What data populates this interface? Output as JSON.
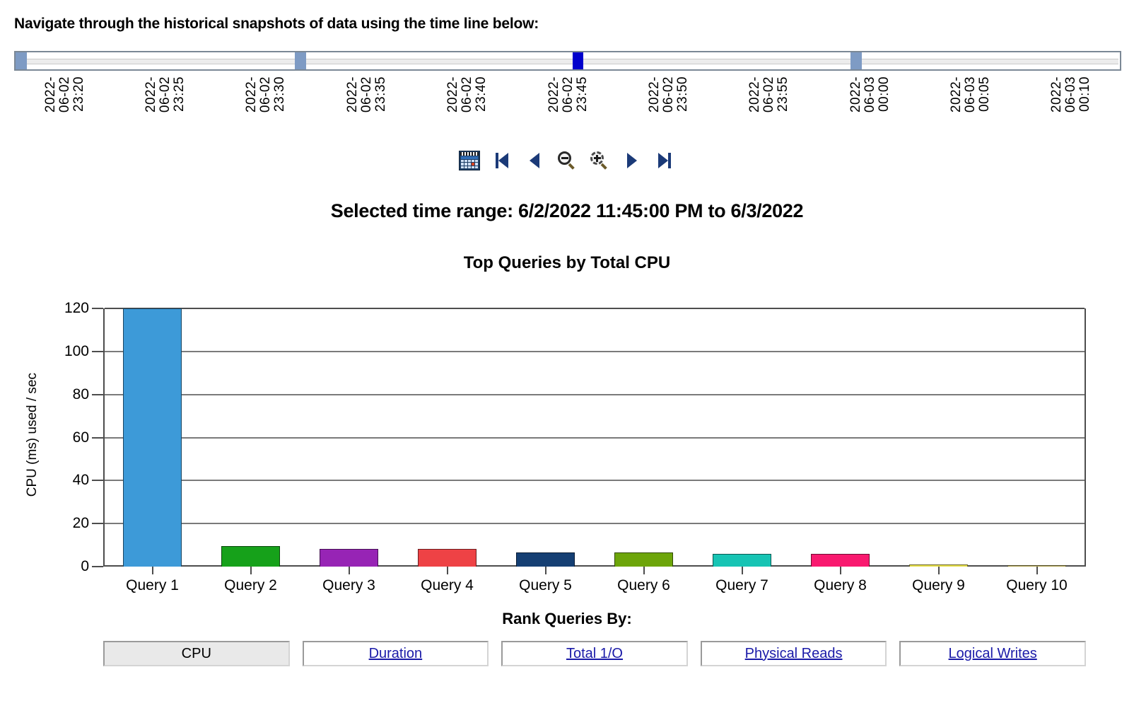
{
  "header": {
    "instruction": "Navigate through the historical snapshots of data using the time line below:"
  },
  "timeline": {
    "tick_labels": [
      {
        "date": "2022-",
        "month": "06-02",
        "time": "23:20"
      },
      {
        "date": "2022-",
        "month": "06-02",
        "time": "23:25"
      },
      {
        "date": "2022-",
        "month": "06-02",
        "time": "23:30"
      },
      {
        "date": "2022-",
        "month": "06-02",
        "time": "23:35"
      },
      {
        "date": "2022-",
        "month": "06-02",
        "time": "23:40"
      },
      {
        "date": "2022-",
        "month": "06-02",
        "time": "23:45"
      },
      {
        "date": "2022-",
        "month": "06-02",
        "time": "23:50"
      },
      {
        "date": "2022-",
        "month": "06-02",
        "time": "23:55"
      },
      {
        "date": "2022-",
        "month": "06-03",
        "time": "00:00"
      },
      {
        "date": "2022-",
        "month": "06-03",
        "time": "00:05"
      },
      {
        "date": "2022-",
        "month": "06-03",
        "time": "00:10"
      }
    ],
    "handles": [
      {
        "name": "handle-start",
        "left_pct": 0.0,
        "selected": false
      },
      {
        "name": "handle-mid-1",
        "left_pct": 25.2,
        "selected": false
      },
      {
        "name": "handle-selected",
        "left_pct": 50.3,
        "selected": true
      },
      {
        "name": "handle-mid-2",
        "left_pct": 75.4,
        "selected": false
      }
    ],
    "selected_color": "#0000cc",
    "handle_color": "#7e9bc4"
  },
  "toolbar": {
    "buttons": [
      {
        "icon": "calendar-icon",
        "label": "Calendar"
      },
      {
        "icon": "skip-to-start-icon",
        "label": "First snapshot"
      },
      {
        "icon": "previous-icon",
        "label": "Previous snapshot"
      },
      {
        "icon": "zoom-out-icon",
        "label": "Zoom out"
      },
      {
        "icon": "zoom-in-icon",
        "label": "Zoom in"
      },
      {
        "icon": "next-icon",
        "label": "Next snapshot"
      },
      {
        "icon": "skip-to-end-icon",
        "label": "Last snapshot"
      }
    ]
  },
  "selected_range": {
    "text": "Selected time range: 6/2/2022 11:45:00 PM to 6/3/2022"
  },
  "chart_data": {
    "type": "bar",
    "title": "Top Queries by Total CPU",
    "xlabel": "",
    "ylabel": "CPU (ms) used / sec",
    "ylim": [
      0,
      120
    ],
    "yticks": [
      0,
      20,
      40,
      60,
      80,
      100,
      120
    ],
    "grid": true,
    "legend": "none",
    "categories": [
      "Query 1",
      "Query 2",
      "Query 3",
      "Query 4",
      "Query 5",
      "Query 6",
      "Query 7",
      "Query 8",
      "Query 9",
      "Query 10"
    ],
    "values": [
      120,
      9.5,
      8.3,
      8.2,
      6.6,
      6.5,
      5.9,
      6.0,
      0.9,
      0.7
    ],
    "colors": [
      "#3d9ad8",
      "#16a11a",
      "#9724b5",
      "#ee4245",
      "#153f73",
      "#6da50a",
      "#17c4b4",
      "#f9196f",
      "#e8e04e",
      "#b5a85a"
    ]
  },
  "rank": {
    "title": "Rank Queries By:",
    "options": [
      {
        "label": "CPU",
        "active": true
      },
      {
        "label": "Duration",
        "active": false
      },
      {
        "label": "Total 1/O",
        "active": false
      },
      {
        "label": "Physical Reads",
        "active": false
      },
      {
        "label": "Logical Writes",
        "active": false
      }
    ]
  }
}
